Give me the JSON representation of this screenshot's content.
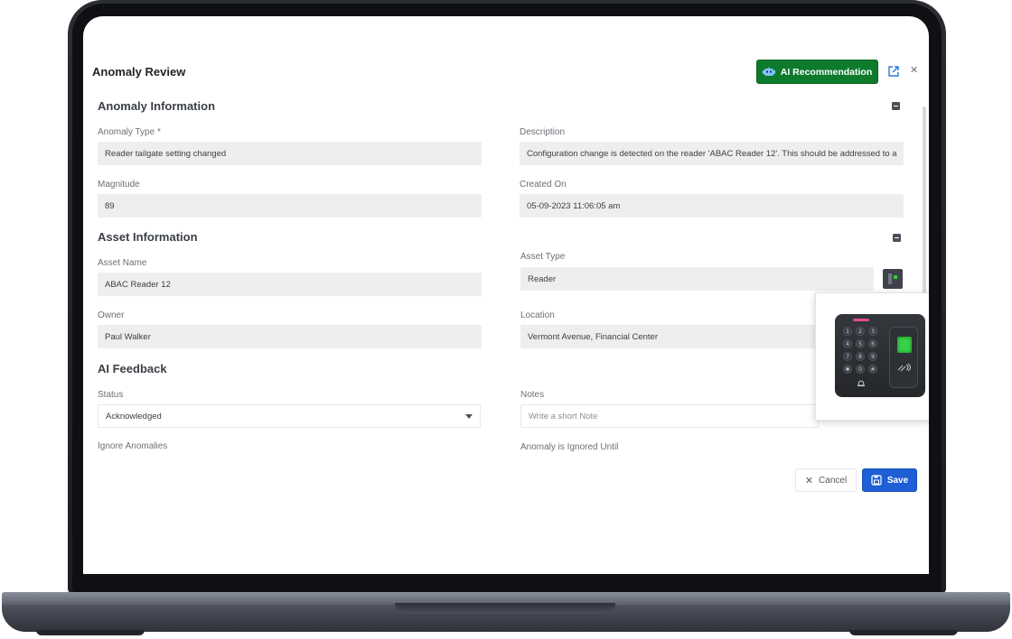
{
  "modal": {
    "title": "Anomaly Review",
    "ai_button_label": "AI Recommendation",
    "ai_button_color": "#0d7a2c"
  },
  "anomaly_information": {
    "section_title": "Anomaly Information",
    "anomaly_type_label": "Anomaly Type *",
    "anomaly_type_value": "Reader tailgate setting changed",
    "description_label": "Description",
    "description_value": "Configuration change is detected on the reader 'ABAC Reader 12'. This should be addressed to a",
    "magnitude_label": "Magnitude",
    "magnitude_value": "89",
    "created_on_label": "Created On",
    "created_on_value": "05-09-2023 11:06:05 am"
  },
  "asset_information": {
    "section_title": "Asset Information",
    "asset_name_label": "Asset Name",
    "asset_name_value": "ABAC Reader 12",
    "asset_type_label": "Asset Type",
    "asset_type_value": "Reader",
    "owner_label": "Owner",
    "owner_value": "Paul Walker",
    "location_label": "Location",
    "location_value": "Vermont Avenue, Financial Center"
  },
  "reader_preview": {
    "keys": [
      "1",
      "2",
      "3",
      "4",
      "5",
      "6",
      "7",
      "8",
      "9",
      "✱",
      "0",
      "#"
    ]
  },
  "ai_feedback": {
    "section_title": "AI Feedback",
    "status_label": "Status",
    "status_value": "Acknowledged",
    "notes_label": "Notes",
    "notes_placeholder": "Write a short Note",
    "ignore_anomalies_label": "Ignore Anomalies",
    "ignored_until_label": "Anomaly is Ignored Until"
  },
  "footer": {
    "cancel_label": "Cancel",
    "save_label": "Save",
    "save_color": "#1e5fd6"
  }
}
